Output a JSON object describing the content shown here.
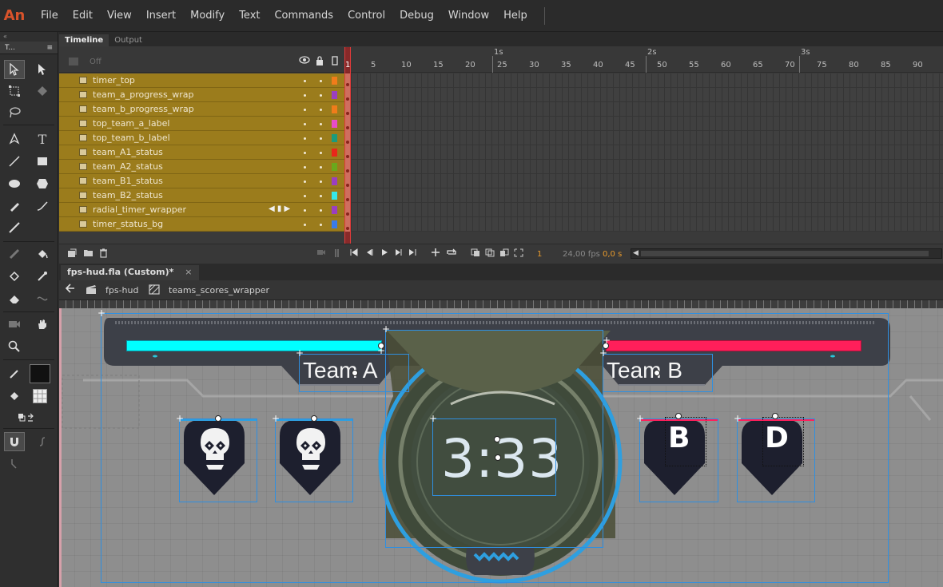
{
  "app": {
    "logo": "An"
  },
  "menu": [
    "File",
    "Edit",
    "View",
    "Insert",
    "Modify",
    "Text",
    "Commands",
    "Control",
    "Debug",
    "Window",
    "Help"
  ],
  "tools_panel": {
    "collapse": "«",
    "tab_label": "T...",
    "tab_menu": "≡"
  },
  "timeline": {
    "tabs": [
      "Timeline",
      "Output"
    ],
    "off_label": "Off",
    "seconds": [
      "1s",
      "2s",
      "3s"
    ],
    "frame_numbers": [
      "1",
      "5",
      "10",
      "15",
      "20",
      "25",
      "30",
      "35",
      "40",
      "45",
      "50",
      "55",
      "60",
      "65",
      "70",
      "75",
      "80",
      "85",
      "90"
    ],
    "layers": [
      {
        "name": "timer_top",
        "color": "#f07c1a"
      },
      {
        "name": "team_a_progress_wrap",
        "color": "#9b3fbf"
      },
      {
        "name": "team_b_progress_wrap",
        "color": "#f07c1a"
      },
      {
        "name": "top_team_a_label",
        "color": "#e84cc8"
      },
      {
        "name": "top_team_b_label",
        "color": "#1a9b7c"
      },
      {
        "name": "team_A1_status",
        "color": "#e8261a"
      },
      {
        "name": "team_A2_status",
        "color": "#6aa81c"
      },
      {
        "name": "team_B1_status",
        "color": "#9b3fbf"
      },
      {
        "name": "team_B2_status",
        "color": "#35e8e8"
      },
      {
        "name": "radial_timer_wrapper",
        "color": "#9b3fbf"
      },
      {
        "name": "timer_status_bg",
        "color": "#3a7be8"
      }
    ],
    "current_frame": "1",
    "fps": "24,00 fps",
    "time": "0,0 s"
  },
  "document": {
    "tab_label": "fps-hud.fla (Custom)*",
    "close": "×",
    "breadcrumbs": [
      "fps-hud",
      "teams_scores_wrapper"
    ]
  },
  "stage": {
    "team_a_label": "Team A",
    "team_b_label": "Team B",
    "timer": "3:33",
    "team_b_avatars": [
      "B",
      "D"
    ],
    "team_a_bar_color": "#00ffff",
    "team_b_bar_color": "#ff1f5a"
  }
}
